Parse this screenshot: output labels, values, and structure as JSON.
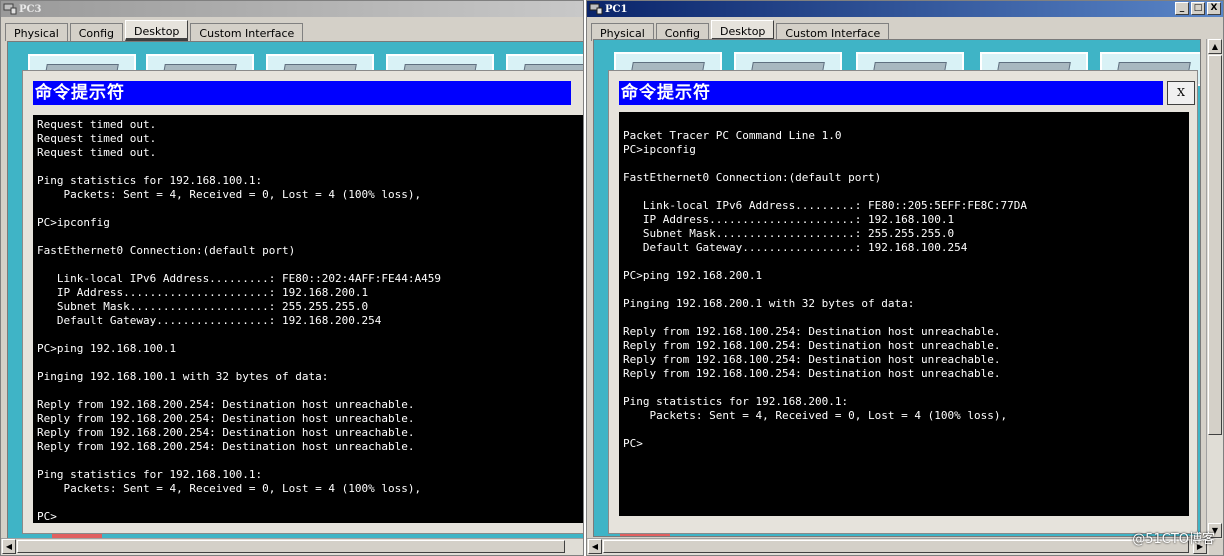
{
  "windows": [
    {
      "title": "PC3",
      "tabs": [
        "Physical",
        "Config",
        "Desktop",
        "Custom Interface"
      ],
      "active_tab": "Desktop",
      "cmd_title": "命令提示符",
      "terminal_lines": [
        "Request timed out.",
        "Request timed out.",
        "Request timed out.",
        "",
        "Ping statistics for 192.168.100.1:",
        "    Packets: Sent = 4, Received = 0, Lost = 4 (100% loss),",
        "",
        "PC>ipconfig",
        "",
        "FastEthernet0 Connection:(default port)",
        "",
        "   Link-local IPv6 Address.........: FE80::202:4AFF:FE44:A459",
        "   IP Address......................: 192.168.200.1",
        "   Subnet Mask.....................: 255.255.255.0",
        "   Default Gateway.................: 192.168.200.254",
        "",
        "PC>ping 192.168.100.1",
        "",
        "Pinging 192.168.100.1 with 32 bytes of data:",
        "",
        "Reply from 192.168.200.254: Destination host unreachable.",
        "Reply from 192.168.200.254: Destination host unreachable.",
        "Reply from 192.168.200.254: Destination host unreachable.",
        "Reply from 192.168.200.254: Destination host unreachable.",
        "",
        "Ping statistics for 192.168.100.1:",
        "    Packets: Sent = 4, Received = 0, Lost = 4 (100% loss),",
        "",
        "PC>"
      ]
    },
    {
      "title": "PC1",
      "tabs": [
        "Physical",
        "Config",
        "Desktop",
        "Custom Interface"
      ],
      "active_tab": "Desktop",
      "cmd_title": "命令提示符",
      "close_label": "X",
      "window_buttons": [
        "_",
        "□",
        "X"
      ],
      "terminal_lines": [
        "",
        "Packet Tracer PC Command Line 1.0",
        "PC>ipconfig",
        "",
        "FastEthernet0 Connection:(default port)",
        "",
        "   Link-local IPv6 Address.........: FE80::205:5EFF:FE8C:77DA",
        "   IP Address......................: 192.168.100.1",
        "   Subnet Mask.....................: 255.255.255.0",
        "   Default Gateway.................: 192.168.100.254",
        "",
        "PC>ping 192.168.200.1",
        "",
        "Pinging 192.168.200.1 with 32 bytes of data:",
        "",
        "Reply from 192.168.100.254: Destination host unreachable.",
        "Reply from 192.168.100.254: Destination host unreachable.",
        "Reply from 192.168.100.254: Destination host unreachable.",
        "Reply from 192.168.100.254: Destination host unreachable.",
        "",
        "Ping statistics for 192.168.200.1:",
        "    Packets: Sent = 4, Received = 0, Lost = 4 (100% loss),",
        "",
        "PC>"
      ]
    }
  ],
  "watermark": "@51CTO博客",
  "colors": {
    "cmd_title_bar": "#0000ff",
    "terminal_bg": "#000000",
    "terminal_fg": "#ffffff",
    "desktop_bg": "#3fb4c6",
    "active_titlebar": "#0a246a",
    "inactive_titlebar": "#9a9a9a"
  }
}
